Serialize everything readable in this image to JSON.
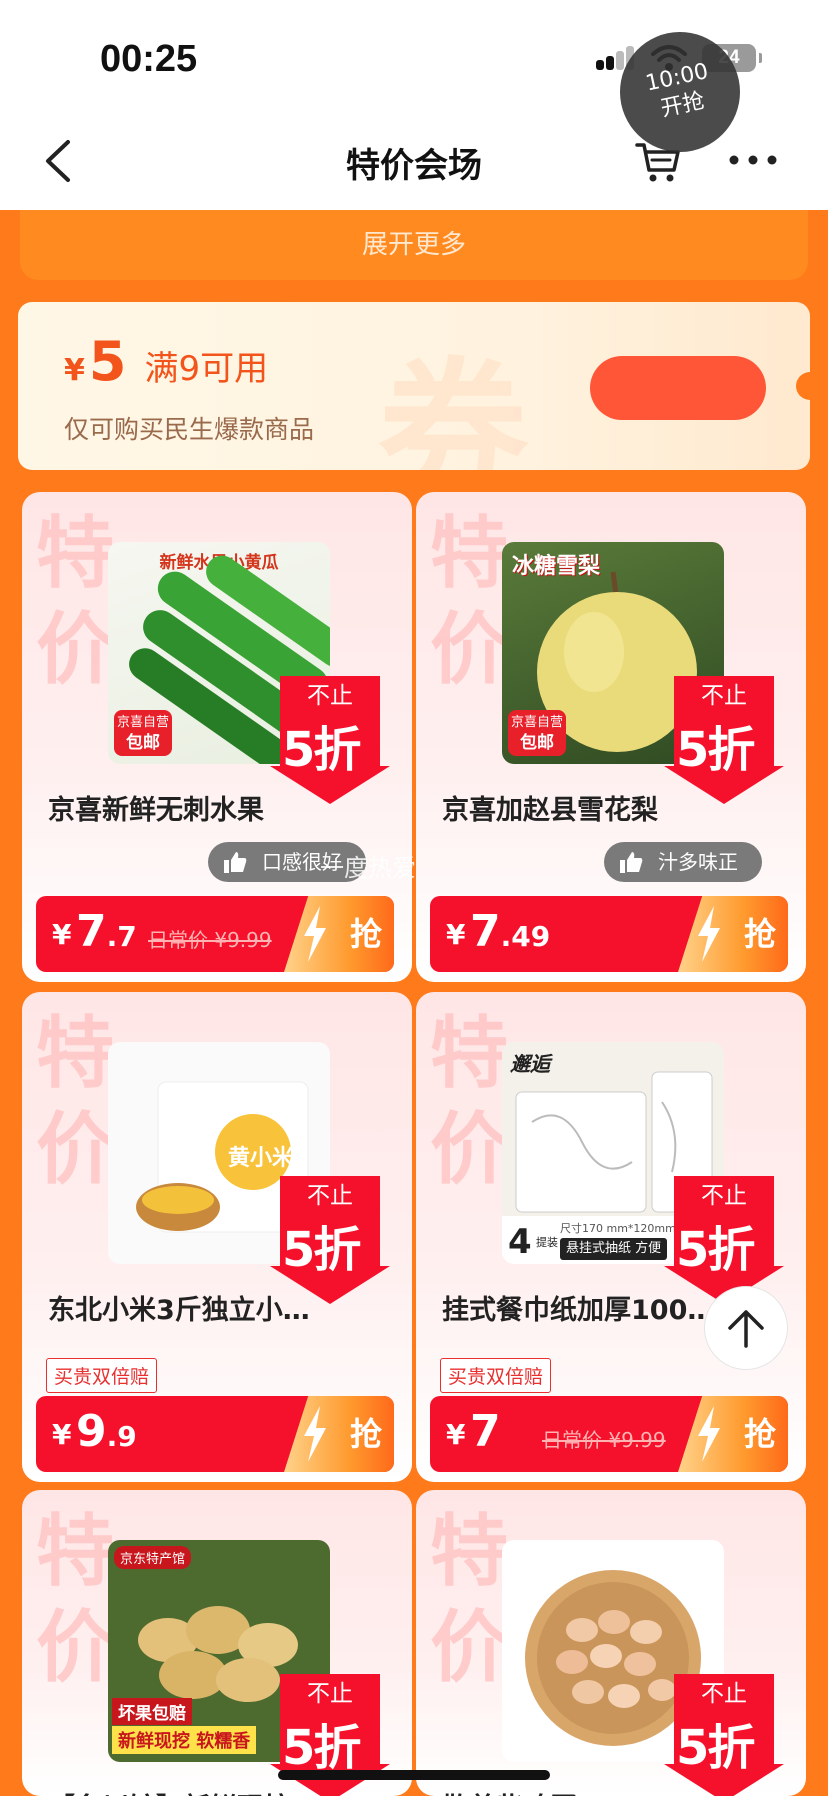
{
  "status": {
    "time": "00:25",
    "battery": "24"
  },
  "nav": {
    "title": "特价会场"
  },
  "expand": {
    "label": "展开更多"
  },
  "coupon": {
    "currency": "¥",
    "amount": "5",
    "condition": "满9可用",
    "description": "仅可购买民生爆款商品",
    "watermark": "券",
    "timer_time": "10:00",
    "timer_label": "开抢"
  },
  "card_watermark": "特价",
  "discount_tag": {
    "top": "不止",
    "main": "5折"
  },
  "grab_label": "抢",
  "overlay_watermark": "一度热爱",
  "products": [
    {
      "name": "京喜新鲜无刺水果",
      "image_label": "新鲜水果小黄瓜",
      "badge_top": "京喜自营",
      "badge_bottom": "包邮",
      "sub_tag": "口感很好",
      "price_int": "7",
      "price_dec": ".7",
      "original_price": "日常价 ¥9.99"
    },
    {
      "name": "京喜加赵县雪花梨",
      "image_label": "冰糖雪梨",
      "badge_top": "京喜自营",
      "badge_bottom": "包邮",
      "sub_tag": "汁多味正",
      "price_int": "7",
      "price_dec": ".49",
      "original_price": ""
    },
    {
      "name": "东北小米3斤独立小…",
      "image_label": "黄小米",
      "promo_tag": "买贵双倍赔",
      "price_int": "9",
      "price_dec": ".9",
      "original_price": ""
    },
    {
      "name": "挂式餐巾纸加厚100…",
      "image_label": "邂逅",
      "image_caption": "悬挂式抽纸 方便",
      "image_count": "4",
      "image_count_unit": "提装",
      "image_size": "尺寸170 mm*120mm",
      "promo_tag": "买贵双倍赔",
      "price_int": "7",
      "price_dec": "",
      "original_price": "日常价 ¥9.99"
    },
    {
      "name": "【名川馆】新鲜现挖",
      "image_label": "京东特产馆",
      "image_caption_1": "坏果包赔",
      "image_caption_2": "新鲜现挖 软糯香"
    },
    {
      "name": "散养柴鸡蛋",
      "image_label": ""
    }
  ],
  "colors": {
    "accent": "#f5112b",
    "page_bg": "#ff7a1a"
  }
}
